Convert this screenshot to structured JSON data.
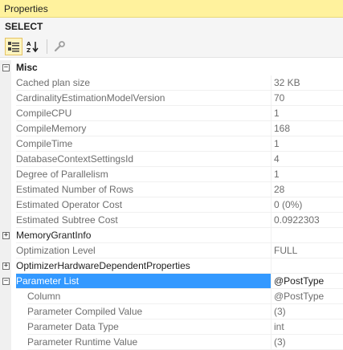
{
  "window": {
    "title": "Properties"
  },
  "object": {
    "name": "SELECT"
  },
  "toolbar": {
    "categorized_icon": "categorized-icon",
    "alphabetical_icon": "alphabetical-icon",
    "property_pages_icon": "wrench-icon"
  },
  "colors": {
    "title_bg": "#fff29d",
    "selection": "#3399ff",
    "active_button": "#fdf4bf"
  },
  "grid": {
    "misc": {
      "label": "Misc",
      "props": [
        {
          "name": "Cached plan size",
          "value": "32 KB"
        },
        {
          "name": "CardinalityEstimationModelVersion",
          "value": "70"
        },
        {
          "name": "CompileCPU",
          "value": "1"
        },
        {
          "name": "CompileMemory",
          "value": "168"
        },
        {
          "name": "CompileTime",
          "value": "1"
        },
        {
          "name": "DatabaseContextSettingsId",
          "value": "4"
        },
        {
          "name": "Degree of Parallelism",
          "value": "1"
        },
        {
          "name": "Estimated Number of Rows",
          "value": "28"
        },
        {
          "name": "Estimated Operator Cost",
          "value": "0 (0%)"
        },
        {
          "name": "Estimated Subtree Cost",
          "value": "0.0922303"
        }
      ]
    },
    "memory_grant": {
      "name": "MemoryGrantInfo",
      "value": ""
    },
    "optimization_level": {
      "name": "Optimization Level",
      "value": "FULL"
    },
    "optimizer_hw": {
      "name": "OptimizerHardwareDependentProperties",
      "value": ""
    },
    "parameter_list": {
      "name": "Parameter List",
      "value": "@PostType",
      "children": [
        {
          "name": "Column",
          "value": "@PostType"
        },
        {
          "name": "Parameter Compiled Value",
          "value": "(3)"
        },
        {
          "name": "Parameter Data Type",
          "value": "int"
        },
        {
          "name": "Parameter Runtime Value",
          "value": "(3)"
        }
      ]
    }
  }
}
